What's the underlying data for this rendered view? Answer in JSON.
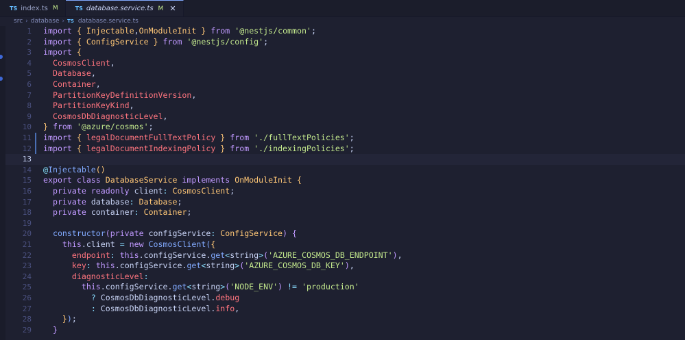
{
  "tabs": [
    {
      "icon": "TS",
      "name": "index.ts",
      "status": "M",
      "active": false
    },
    {
      "icon": "TS",
      "name": "database.service.ts",
      "status": "M",
      "active": true,
      "close": "✕"
    }
  ],
  "breadcrumb": [
    "src",
    "database",
    "database.service.ts"
  ],
  "editor": {
    "active_line": 13,
    "lines": [
      [
        [
          "kw",
          "import "
        ],
        [
          "br1",
          "{ "
        ],
        [
          "cls",
          "Injectable"
        ],
        [
          "",
          ","
        ],
        [
          "cls",
          "OnModuleInit"
        ],
        [
          "br1",
          " }"
        ],
        [
          "kw",
          " from "
        ],
        [
          "str",
          "'@nestjs/common'"
        ],
        [
          "",
          ";"
        ]
      ],
      [
        [
          "kw",
          "import "
        ],
        [
          "br1",
          "{ "
        ],
        [
          "cls",
          "ConfigService"
        ],
        [
          "br1",
          " }"
        ],
        [
          "kw",
          " from "
        ],
        [
          "str",
          "'@nestjs/config'"
        ],
        [
          "",
          ";"
        ]
      ],
      [
        [
          "kw",
          "import "
        ],
        [
          "br1",
          "{"
        ]
      ],
      [
        [
          "",
          "  "
        ],
        [
          "prop",
          "CosmosClient"
        ],
        [
          "",
          ","
        ]
      ],
      [
        [
          "",
          "  "
        ],
        [
          "prop",
          "Database"
        ],
        [
          "",
          ","
        ]
      ],
      [
        [
          "",
          "  "
        ],
        [
          "prop",
          "Container"
        ],
        [
          "",
          ","
        ]
      ],
      [
        [
          "",
          "  "
        ],
        [
          "prop",
          "PartitionKeyDefinitionVersion"
        ],
        [
          "",
          ","
        ]
      ],
      [
        [
          "",
          "  "
        ],
        [
          "prop",
          "PartitionKeyKind"
        ],
        [
          "",
          ","
        ]
      ],
      [
        [
          "",
          "  "
        ],
        [
          "prop",
          "CosmosDbDiagnosticLevel"
        ],
        [
          "",
          ","
        ]
      ],
      [
        [
          "br1",
          "}"
        ],
        [
          "kw",
          " from "
        ],
        [
          "str",
          "'@azure/cosmos'"
        ],
        [
          "",
          ";"
        ]
      ],
      [
        [
          "kw",
          "import "
        ],
        [
          "br1",
          "{ "
        ],
        [
          "prop",
          "legalDocumentFullTextPolicy"
        ],
        [
          "br1",
          " }"
        ],
        [
          "kw",
          " from "
        ],
        [
          "str",
          "'./fullTextPolicies'"
        ],
        [
          "",
          ";"
        ]
      ],
      [
        [
          "kw",
          "import "
        ],
        [
          "br1",
          "{ "
        ],
        [
          "prop",
          "legalDocumentIndexingPolicy"
        ],
        [
          "br1",
          " }"
        ],
        [
          "kw",
          " from "
        ],
        [
          "str",
          "'./indexingPolicies'"
        ],
        [
          "",
          ";"
        ]
      ],
      [],
      [
        [
          "dec",
          "@"
        ],
        [
          "fn",
          "Injectable"
        ],
        [
          "br1",
          "()"
        ]
      ],
      [
        [
          "kw",
          "export class "
        ],
        [
          "cls",
          "DatabaseService"
        ],
        [
          "kw",
          " implements "
        ],
        [
          "cls",
          "OnModuleInit"
        ],
        [
          "br1",
          " {"
        ]
      ],
      [
        [
          "",
          "  "
        ],
        [
          "kw",
          "private readonly "
        ],
        [
          "",
          "client"
        ],
        [
          "op",
          ": "
        ],
        [
          "cls",
          "CosmosClient"
        ],
        [
          "",
          ";"
        ]
      ],
      [
        [
          "",
          "  "
        ],
        [
          "kw",
          "private "
        ],
        [
          "",
          "database"
        ],
        [
          "op",
          ": "
        ],
        [
          "cls",
          "Database"
        ],
        [
          "",
          ";"
        ]
      ],
      [
        [
          "",
          "  "
        ],
        [
          "kw",
          "private "
        ],
        [
          "",
          "container"
        ],
        [
          "op",
          ": "
        ],
        [
          "cls",
          "Container"
        ],
        [
          "",
          ";"
        ]
      ],
      [],
      [
        [
          "",
          "  "
        ],
        [
          "fn",
          "constructor"
        ],
        [
          "br2",
          "("
        ],
        [
          "kw",
          "private "
        ],
        [
          "",
          "configService"
        ],
        [
          "op",
          ": "
        ],
        [
          "cls",
          "ConfigService"
        ],
        [
          "br2",
          ")"
        ],
        [
          "br2",
          " {"
        ]
      ],
      [
        [
          "",
          "    "
        ],
        [
          "kw",
          "this"
        ],
        [
          "",
          ".client "
        ],
        [
          "op",
          "= "
        ],
        [
          "kw",
          "new "
        ],
        [
          "fn",
          "CosmosClient"
        ],
        [
          "br3",
          "("
        ],
        [
          "br1",
          "{"
        ]
      ],
      [
        [
          "",
          "      "
        ],
        [
          "prop",
          "endpoint"
        ],
        [
          "op",
          ": "
        ],
        [
          "kw",
          "this"
        ],
        [
          "",
          ".configService."
        ],
        [
          "fn",
          "get"
        ],
        [
          "op",
          "<"
        ],
        [
          "",
          "string"
        ],
        [
          "op",
          ">"
        ],
        [
          "br2",
          "("
        ],
        [
          "str",
          "'AZURE_COSMOS_DB_ENDPOINT'"
        ],
        [
          "br2",
          ")"
        ],
        [
          "",
          ","
        ]
      ],
      [
        [
          "",
          "      "
        ],
        [
          "prop",
          "key"
        ],
        [
          "op",
          ": "
        ],
        [
          "kw",
          "this"
        ],
        [
          "",
          ".configService."
        ],
        [
          "fn",
          "get"
        ],
        [
          "op",
          "<"
        ],
        [
          "",
          "string"
        ],
        [
          "op",
          ">"
        ],
        [
          "br2",
          "("
        ],
        [
          "str",
          "'AZURE_COSMOS_DB_KEY'"
        ],
        [
          "br2",
          ")"
        ],
        [
          "",
          ","
        ]
      ],
      [
        [
          "",
          "      "
        ],
        [
          "prop",
          "diagnosticLevel"
        ],
        [
          "op",
          ":"
        ]
      ],
      [
        [
          "",
          "        "
        ],
        [
          "kw",
          "this"
        ],
        [
          "",
          ".configService."
        ],
        [
          "fn",
          "get"
        ],
        [
          "op",
          "<"
        ],
        [
          "",
          "string"
        ],
        [
          "op",
          ">"
        ],
        [
          "br2",
          "("
        ],
        [
          "str",
          "'NODE_ENV'"
        ],
        [
          "br2",
          ")"
        ],
        [
          "op",
          " != "
        ],
        [
          "str",
          "'production'"
        ]
      ],
      [
        [
          "",
          "          "
        ],
        [
          "op",
          "? "
        ],
        [
          "",
          "CosmosDbDiagnosticLevel."
        ],
        [
          "prop",
          "debug"
        ]
      ],
      [
        [
          "",
          "          "
        ],
        [
          "op",
          ": "
        ],
        [
          "",
          "CosmosDbDiagnosticLevel."
        ],
        [
          "prop",
          "info"
        ],
        [
          "",
          ","
        ]
      ],
      [
        [
          "",
          "    "
        ],
        [
          "br1",
          "}"
        ],
        [
          "br3",
          ")"
        ],
        [
          "",
          ";"
        ]
      ],
      [
        [
          "",
          "  "
        ],
        [
          "br2",
          "}"
        ]
      ]
    ]
  }
}
